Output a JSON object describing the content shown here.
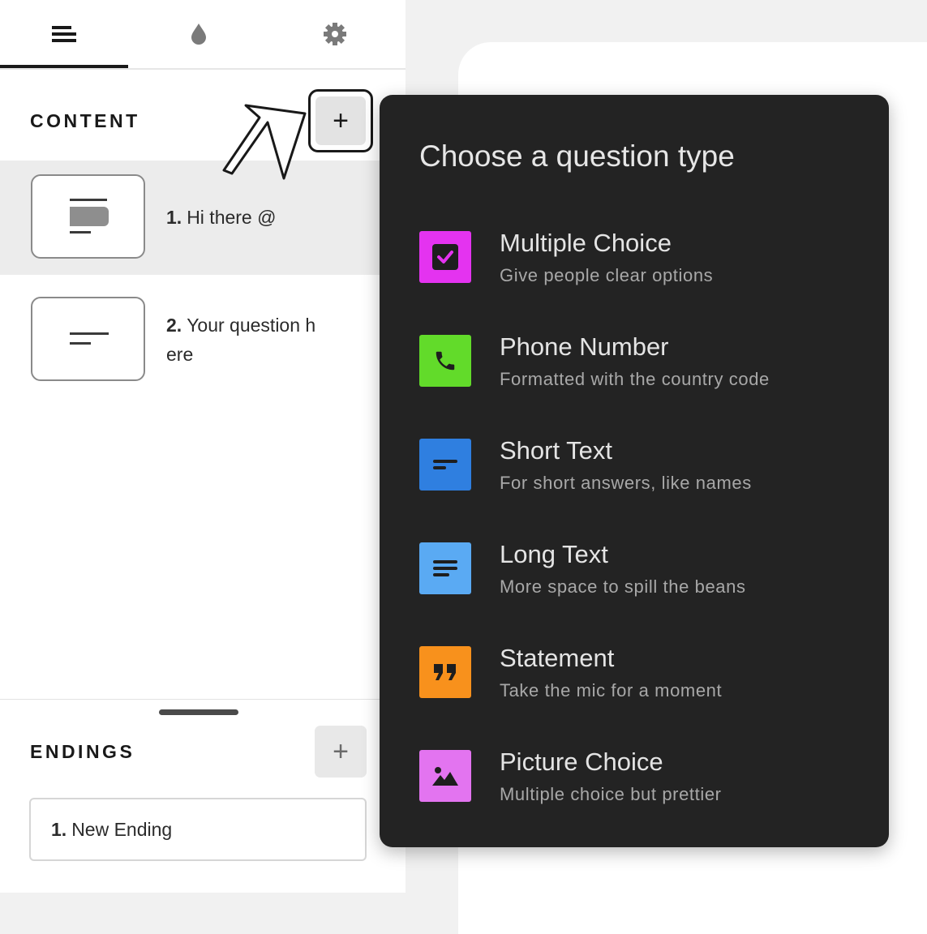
{
  "sidebar": {
    "tabs": [
      {
        "icon": "content-lines-icon",
        "active": true
      },
      {
        "icon": "droplet-icon",
        "active": false
      },
      {
        "icon": "gear-icon",
        "active": false
      }
    ],
    "content_title": "CONTENT",
    "add_label": "+",
    "questions": [
      {
        "number": "1.",
        "text": "Hi there @",
        "icon": "statement-thumb-icon",
        "active": true
      },
      {
        "number": "2.",
        "text": "Your question h ere",
        "icon": "short-text-thumb-icon",
        "active": false
      }
    ],
    "endings_title": "ENDINGS",
    "endings_add_label": "+",
    "endings": [
      {
        "number": "1.",
        "text": "New Ending"
      }
    ]
  },
  "popup": {
    "title": "Choose a question type",
    "types": [
      {
        "name": "Multiple Choice",
        "desc": "Give people clear options",
        "icon": "checkbox-icon",
        "color": "#e433f0"
      },
      {
        "name": "Phone Number",
        "desc": "Formatted with the country code",
        "icon": "phone-icon",
        "color": "#62db2a"
      },
      {
        "name": "Short Text",
        "desc": "For short answers, like names",
        "icon": "short-text-icon",
        "color": "#2f7fe0"
      },
      {
        "name": "Long Text",
        "desc": "More space to spill the beans",
        "icon": "long-text-icon",
        "color": "#5aaaf3"
      },
      {
        "name": "Statement",
        "desc": "Take the mic for a moment",
        "icon": "quote-icon",
        "color": "#f8911c"
      },
      {
        "name": "Picture Choice",
        "desc": "Multiple choice but prettier",
        "icon": "picture-icon",
        "color": "#e374f0"
      }
    ]
  }
}
